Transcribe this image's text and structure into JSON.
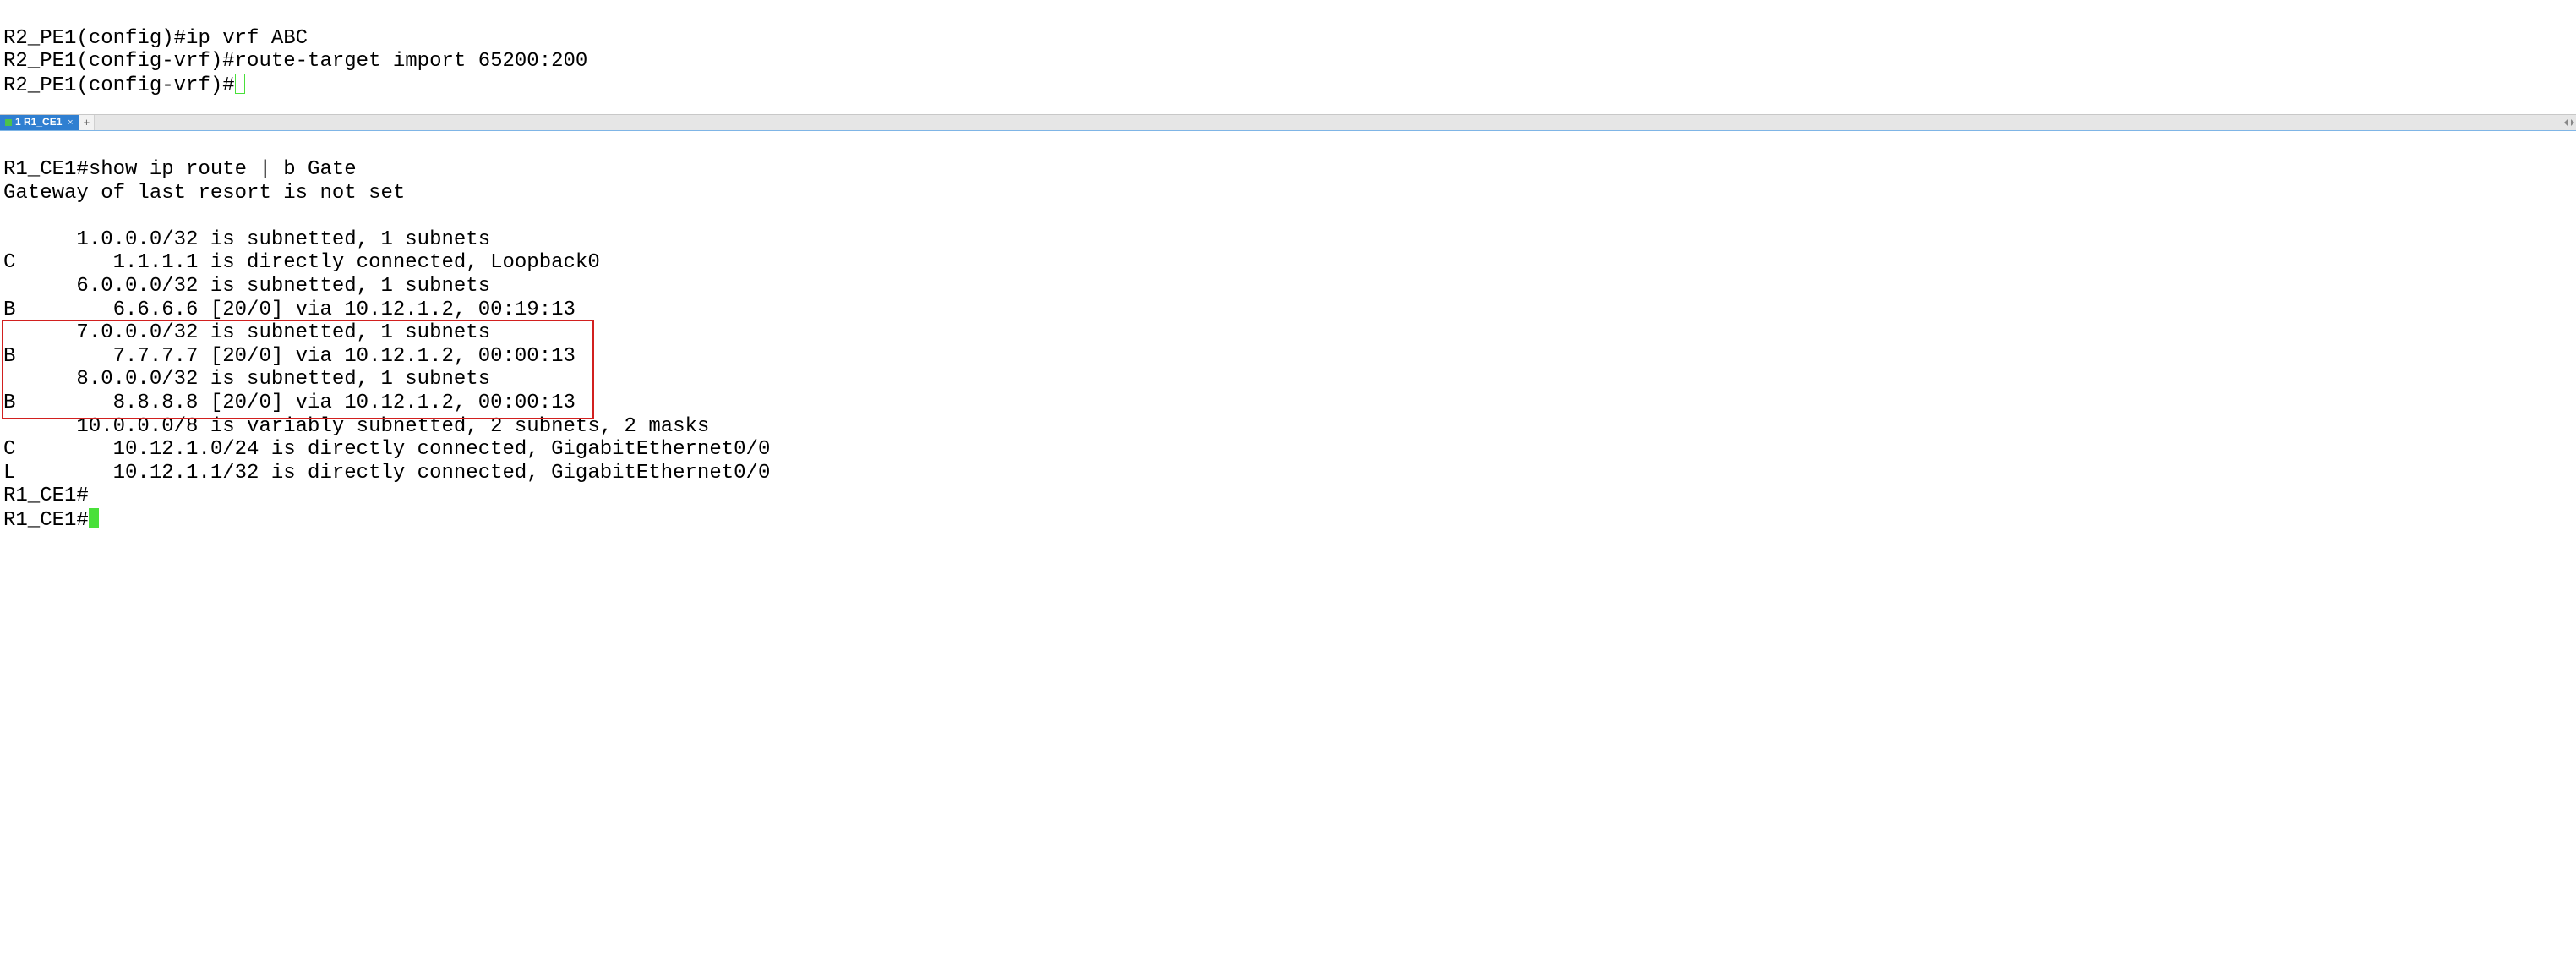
{
  "top_terminal": {
    "lines": [
      "R2_PE1(config)#ip vrf ABC",
      "R2_PE1(config-vrf)#route-target import 65200:200",
      "R2_PE1(config-vrf)#"
    ]
  },
  "tabbar": {
    "active_tab_label": "1 R1_CE1",
    "active_tab_status": "connected",
    "add_label": "+"
  },
  "bottom_terminal": {
    "command_line": "R1_CE1#show ip route | b Gate",
    "gateway_line": "Gateway of last resort is not set",
    "routes": [
      "      1.0.0.0/32 is subnetted, 1 subnets",
      "C        1.1.1.1 is directly connected, Loopback0",
      "      6.0.0.0/32 is subnetted, 1 subnets",
      "B        6.6.6.6 [20/0] via 10.12.1.2, 00:19:13",
      "      7.0.0.0/32 is subnetted, 1 subnets",
      "B        7.7.7.7 [20/0] via 10.12.1.2, 00:00:13",
      "      8.0.0.0/32 is subnetted, 1 subnets",
      "B        8.8.8.8 [20/0] via 10.12.1.2, 00:00:13",
      "      10.0.0.0/8 is variably subnetted, 2 subnets, 2 masks",
      "C        10.12.1.0/24 is directly connected, GigabitEthernet0/0",
      "L        10.12.1.1/32 is directly connected, GigabitEthernet0/0"
    ],
    "prompt_lines": [
      "R1_CE1#",
      "R1_CE1#"
    ]
  },
  "highlight": {
    "from_route_index": 4,
    "to_route_index": 7
  }
}
